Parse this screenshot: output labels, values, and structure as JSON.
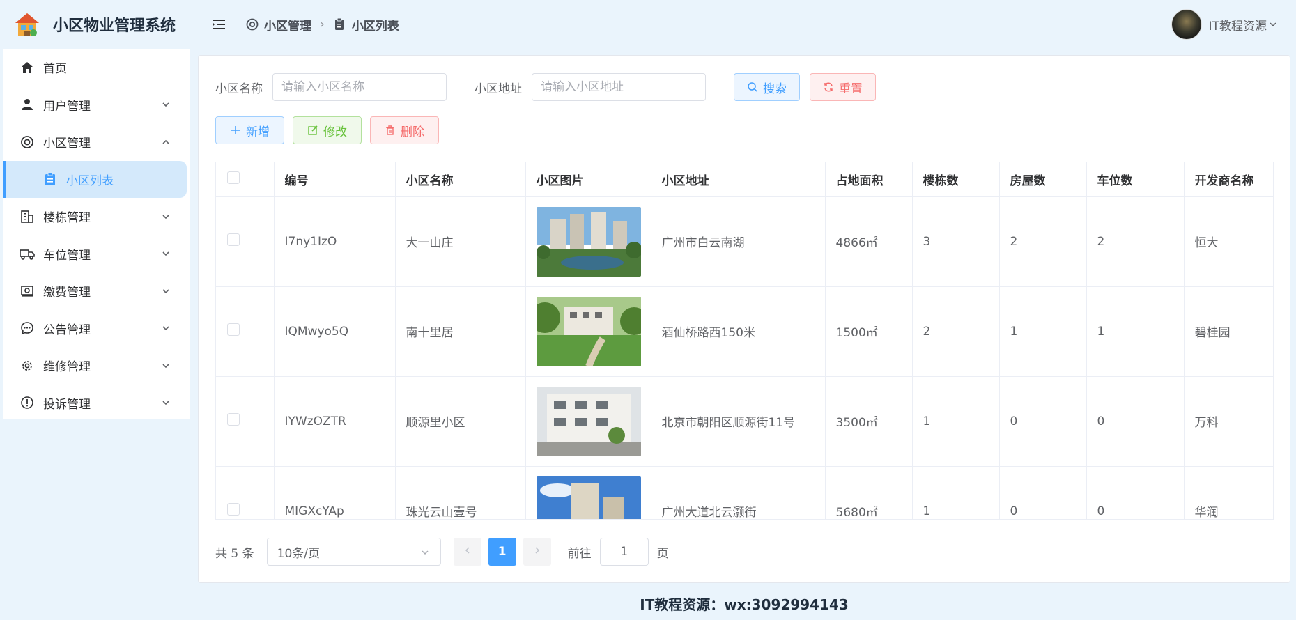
{
  "app": {
    "title": "小区物业管理系统"
  },
  "sidebar": {
    "items": [
      {
        "label": "首页",
        "icon": "home-icon"
      },
      {
        "label": "用户管理",
        "icon": "user-icon"
      },
      {
        "label": "小区管理",
        "icon": "lifebuoy-icon"
      },
      {
        "label": "小区列表",
        "icon": "clipboard-icon"
      },
      {
        "label": "楼栋管理",
        "icon": "building-icon"
      },
      {
        "label": "车位管理",
        "icon": "truck-icon"
      },
      {
        "label": "缴费管理",
        "icon": "wallet-icon"
      },
      {
        "label": "公告管理",
        "icon": "chat-icon"
      },
      {
        "label": "维修管理",
        "icon": "gear-icon"
      },
      {
        "label": "投诉管理",
        "icon": "warning-icon"
      }
    ]
  },
  "header": {
    "breadcrumb": [
      "小区管理",
      "小区列表"
    ],
    "user_name": "IT教程资源"
  },
  "search": {
    "name_label": "小区名称",
    "name_placeholder": "请输入小区名称",
    "address_label": "小区地址",
    "address_placeholder": "请输入小区地址",
    "search_label": "搜索",
    "reset_label": "重置"
  },
  "actions": {
    "add_label": "新增",
    "edit_label": "修改",
    "delete_label": "删除"
  },
  "table": {
    "columns": [
      "编号",
      "小区名称",
      "小区图片",
      "小区地址",
      "占地面积",
      "楼栋数",
      "房屋数",
      "车位数",
      "开发商名称"
    ],
    "rows": [
      {
        "id": "I7ny1IzO",
        "name": "大一山庄",
        "address": "广州市白云南湖",
        "area": "4866㎡",
        "buildings": "3",
        "houses": "2",
        "parking": "2",
        "developer": "恒大"
      },
      {
        "id": "IQMwyo5Q",
        "name": "南十里居",
        "address": "酒仙桥路西150米",
        "area": "1500㎡",
        "buildings": "2",
        "houses": "1",
        "parking": "1",
        "developer": "碧桂园"
      },
      {
        "id": "IYWzOZTR",
        "name": "顺源里小区",
        "address": "北京市朝阳区顺源街11号",
        "area": "3500㎡",
        "buildings": "1",
        "houses": "0",
        "parking": "0",
        "developer": "万科"
      },
      {
        "id": "MIGXcYAp",
        "name": "珠光云山壹号",
        "address": "广州大道北云灏街",
        "area": "5680㎡",
        "buildings": "1",
        "houses": "0",
        "parking": "0",
        "developer": "华润"
      }
    ]
  },
  "pagination": {
    "total_text": "共 5 条",
    "page_size": "10条/页",
    "current_page": "1",
    "goto_label": "前往",
    "goto_value": "1",
    "page_suffix": "页"
  },
  "footer": {
    "text": "IT教程资源：wx:3092994143"
  },
  "colors": {
    "accent": "#409eff",
    "danger": "#f56c6c",
    "success": "#67c23a",
    "background": "#eaf4fc"
  }
}
